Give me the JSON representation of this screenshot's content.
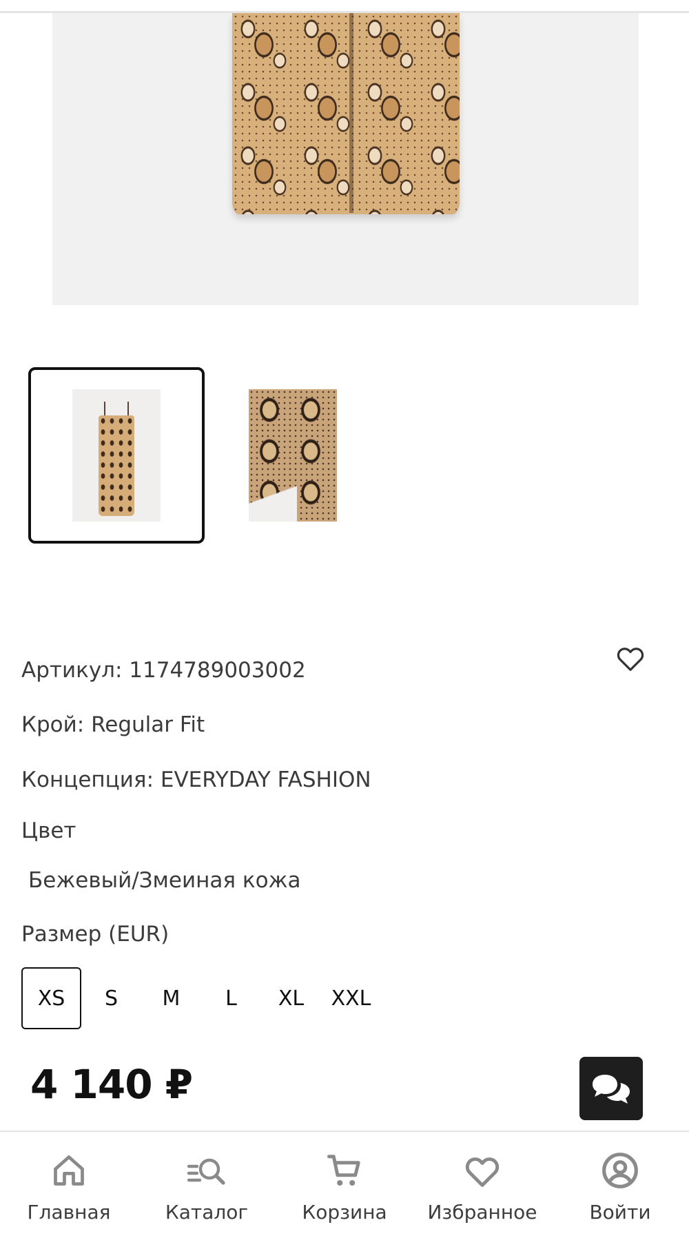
{
  "product": {
    "article_label": "Артикул: 1174789003002",
    "fit_label": "Крой: Regular Fit",
    "concept_label": "Концепция: EVERYDAY FASHION",
    "color_heading": "Цвет",
    "color_value": "Бежевый/Змеиная кожа",
    "size_heading": "Размер (EUR)",
    "sizes": [
      "XS",
      "S",
      "M",
      "L",
      "XL",
      "XXL"
    ],
    "selected_size": "XS",
    "price": "4 140 ₽"
  },
  "gallery": {
    "thumbnails": 2,
    "selected_index": 0
  },
  "icons": {
    "favorite": "heart-outline-icon",
    "chat": "chat-bubbles-icon"
  },
  "bottom_nav": {
    "items": [
      {
        "label": "Главная",
        "icon": "home-icon"
      },
      {
        "label": "Каталог",
        "icon": "catalog-search-icon"
      },
      {
        "label": "Корзина",
        "icon": "cart-icon"
      },
      {
        "label": "Избранное",
        "icon": "heart-icon"
      },
      {
        "label": "Войти",
        "icon": "user-circle-icon"
      }
    ]
  },
  "colors": {
    "text": "#3b3b3b",
    "accent_dark": "#1e1e1e",
    "icon_gray": "#8a8a8a"
  }
}
